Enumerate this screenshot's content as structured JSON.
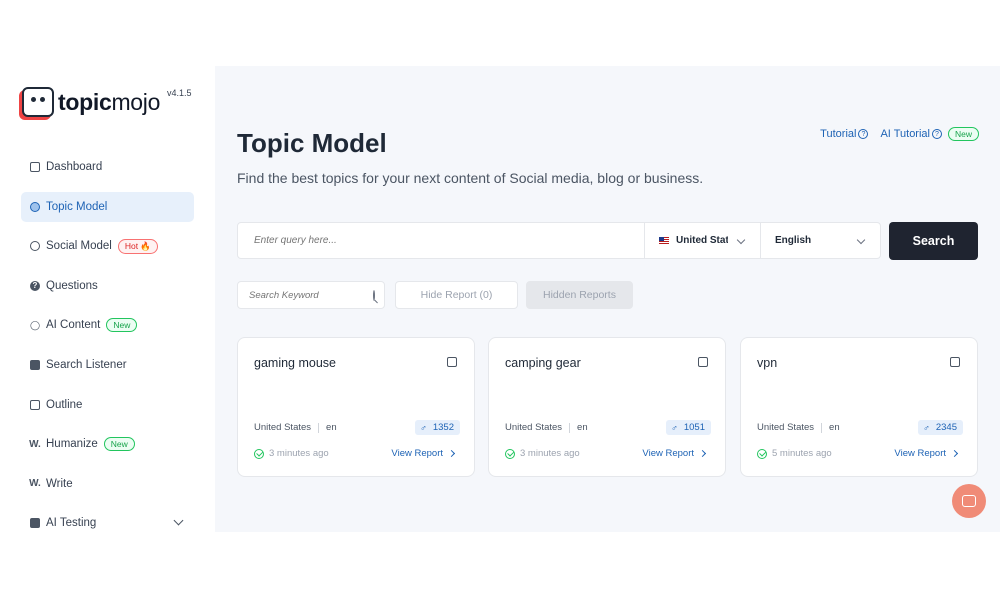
{
  "brand": {
    "name_bold": "topic",
    "name_light": "mojo",
    "version": "v4.1.5"
  },
  "sidebar": {
    "items": [
      {
        "label": "Dashboard",
        "icon": "dashboard-icon"
      },
      {
        "label": "Topic Model",
        "icon": "topic-model-icon",
        "active": true
      },
      {
        "label": "Social Model",
        "icon": "social-model-icon",
        "badge": "Hot 🔥"
      },
      {
        "label": "Questions",
        "icon": "question-icon"
      },
      {
        "label": "AI Content",
        "icon": "bulb-icon",
        "badge": "New"
      },
      {
        "label": "Search Listener",
        "icon": "search-listener-icon"
      },
      {
        "label": "Outline",
        "icon": "outline-icon"
      },
      {
        "label": "Humanize",
        "icon": "humanize-icon",
        "badge": "New"
      },
      {
        "label": "Write",
        "icon": "write-icon"
      },
      {
        "label": "AI Testing",
        "icon": "briefcase-icon"
      }
    ]
  },
  "header": {
    "title": "Topic Model",
    "subtitle": "Find the best topics for your next content of Social media, blog or business.",
    "links": {
      "tutorial": "Tutorial",
      "ai_tutorial": "AI Tutorial",
      "ai_tutorial_badge": "New"
    }
  },
  "search": {
    "query_placeholder": "Enter query here...",
    "country": "United States",
    "language": "English",
    "button_label": "Search"
  },
  "filters": {
    "keyword_placeholder": "Search Keyword",
    "hide_report_label": "Hide Report (0)",
    "hidden_reports_label": "Hidden Reports"
  },
  "cards": [
    {
      "title": "gaming mouse",
      "country": "United States",
      "lang": "en",
      "count": "1352",
      "time": "3 minutes ago",
      "view": "View Report"
    },
    {
      "title": "camping gear",
      "country": "United States",
      "lang": "en",
      "count": "1051",
      "time": "3 minutes ago",
      "view": "View Report"
    },
    {
      "title": "vpn",
      "country": "United States",
      "lang": "en",
      "count": "2345",
      "time": "5 minutes ago",
      "view": "View Report"
    }
  ],
  "colors": {
    "accent": "#1e63b5",
    "dark_button": "#1f2430",
    "success": "#22c55e",
    "hot": "#dc2626",
    "chat": "#f08b77"
  }
}
